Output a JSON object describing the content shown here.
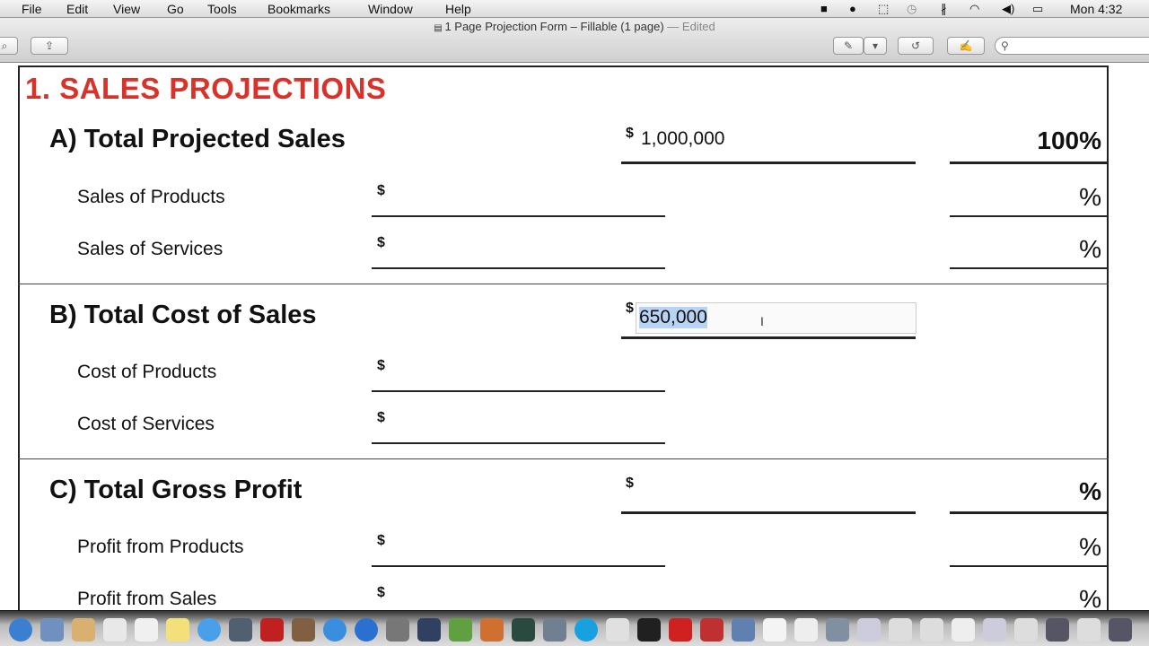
{
  "menubar": {
    "items": [
      "File",
      "Edit",
      "View",
      "Go",
      "Tools",
      "Bookmarks",
      "Window",
      "Help"
    ],
    "clock": "Mon 4:32",
    "tray_icons": [
      "facetime-camera-icon",
      "messages-icon",
      "screenshot-selection-icon",
      "time-machine-icon",
      "bluetooth-icon",
      "wifi-icon",
      "volume-icon",
      "battery-icon"
    ]
  },
  "window": {
    "title": "1 Page Projection Form – Fillable (1 page)",
    "status": "— Edited"
  },
  "toolbar": {
    "search_placeholder": ""
  },
  "form": {
    "heading": "1. SALES PROJECTIONS",
    "currency": "$",
    "percent": "%",
    "sections": [
      {
        "title": "A) Total Projected Sales",
        "value": "1,000,000",
        "percent": "100%",
        "rows": [
          {
            "label": "Sales of Products",
            "value": "",
            "percent": "%"
          },
          {
            "label": "Sales of Services",
            "value": "",
            "percent": "%"
          }
        ]
      },
      {
        "title": "B) Total Cost of Sales",
        "value": "650,000",
        "rows": [
          {
            "label": "Cost of Products",
            "value": ""
          },
          {
            "label": "Cost of Services",
            "value": ""
          }
        ]
      },
      {
        "title": "C) Total Gross Profit",
        "value": "",
        "percent": "%",
        "rows": [
          {
            "label": "Profit from Products",
            "value": "",
            "percent": "%"
          },
          {
            "label": "Profit from Sales",
            "value": "",
            "percent": "%"
          }
        ]
      }
    ]
  },
  "dock": {
    "colors": [
      "#3a7fd0",
      "#7090c0",
      "#d8b070",
      "#e8e8e8",
      "#f0f0f0",
      "#f3e07a",
      "#4aa0e8",
      "#506070",
      "#c02020",
      "#806040",
      "#3a8ee0",
      "#2a70d0",
      "#777",
      "#304060",
      "#60a040",
      "#d07030",
      "#2a4a40",
      "#708090",
      "#18a0e0",
      "#e0e0e0",
      "#202020",
      "#d02020",
      "#c03030",
      "#6080b0",
      "#f4f4f4",
      "#eee",
      "#8090a0",
      "#ccd",
      "#ddd",
      "#ddd",
      "#eee",
      "#ccd",
      "#ddd",
      "#556",
      "#ddd",
      "#556"
    ]
  }
}
